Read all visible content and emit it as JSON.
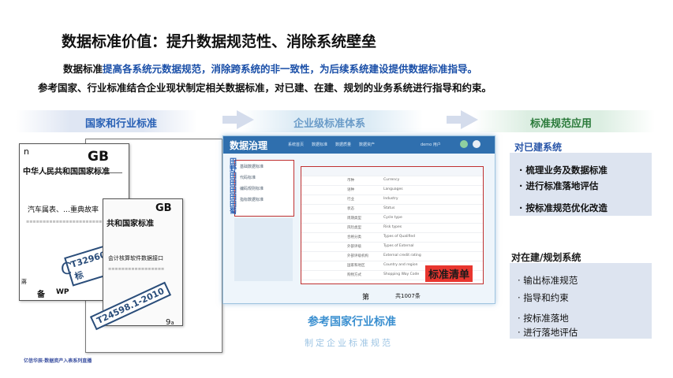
{
  "title": "数据标准价值：提升数据规范性、消除系统壁垒",
  "intro": {
    "line1_prefix": "数据标准",
    "line1_highlight": "提高各系统元数据规范，消除跨系统的非一致性，为后续系统建设提供数据标准指导。",
    "line2": "参考国家、行业标准结合企业现状制定相关数据标准，对已建、在建、规划的业务系统进行指导和约束。"
  },
  "columns": {
    "left_header": "国家和行业标准",
    "middle_header": "企业级标准体系",
    "right_header": "标准规范应用"
  },
  "documents": {
    "doc1_n": "n",
    "doc1_gb": "GB",
    "doc1_title": "中华人民共和国国家标准",
    "doc1_sub": "汽车属表、…重典故率",
    "doc1_stamp": "T32960国标",
    "doc1_c": "C",
    "doc1_footer_a": "备",
    "doc1_footer_b": "WP",
    "doc1_footer_mark": "蔣",
    "doc2_gb": "GB",
    "doc2_title": "共和国家标准",
    "doc2_sub": "会计核算软件数据接口",
    "doc2_stamp": "T24598.1-2010",
    "doc2_page": "9",
    "doc2_page_sub": "a"
  },
  "app": {
    "title": "数据治理",
    "nav": [
      "系统首页",
      "数据标准",
      "数据质量",
      "数据资产"
    ],
    "user": "demo 用户",
    "sidebar_items": [
      "基础数据标准",
      "代码标准",
      "编码规则标准",
      "指标数据标准"
    ],
    "table_rows": [
      {
        "name": "币种",
        "en": "Currency"
      },
      {
        "name": "语种",
        "en": "Languages"
      },
      {
        "name": "行业",
        "en": "Industry"
      },
      {
        "name": "状态",
        "en": "Status"
      },
      {
        "name": "周期类型",
        "en": "Cycle type"
      },
      {
        "name": "风险类型",
        "en": "Risk types"
      },
      {
        "name": "合格分类",
        "en": "Types of Qualified"
      },
      {
        "name": "外部评级",
        "en": "Types of External"
      },
      {
        "name": "外部评级机构",
        "en": "External credit rating"
      },
      {
        "name": "国家和地区",
        "en": "Country and region"
      },
      {
        "name": "购物方式",
        "en": "Shopping Way Code"
      }
    ],
    "footer_page": "第",
    "footer_count": "共1007条",
    "badge": "标准清单",
    "vertical_label": "田野田田田田田蜀"
  },
  "center_label": "参考国家行业标准",
  "center_sub": "制定企业标准规范",
  "right_panels": [
    {
      "title": "对已建系统",
      "items": [
        "· 梳理业务及数据标准",
        "· 进行标准落地评估",
        "· 按标准规范优化改造"
      ]
    },
    {
      "title": "对在建/规划系统",
      "items": [
        "· 输出标准规范",
        "· 指导和约束",
        "· 按标准落地",
        "· 进行落地评估"
      ]
    }
  ],
  "footer": "亿信华辰·数据资产入表系列直播"
}
